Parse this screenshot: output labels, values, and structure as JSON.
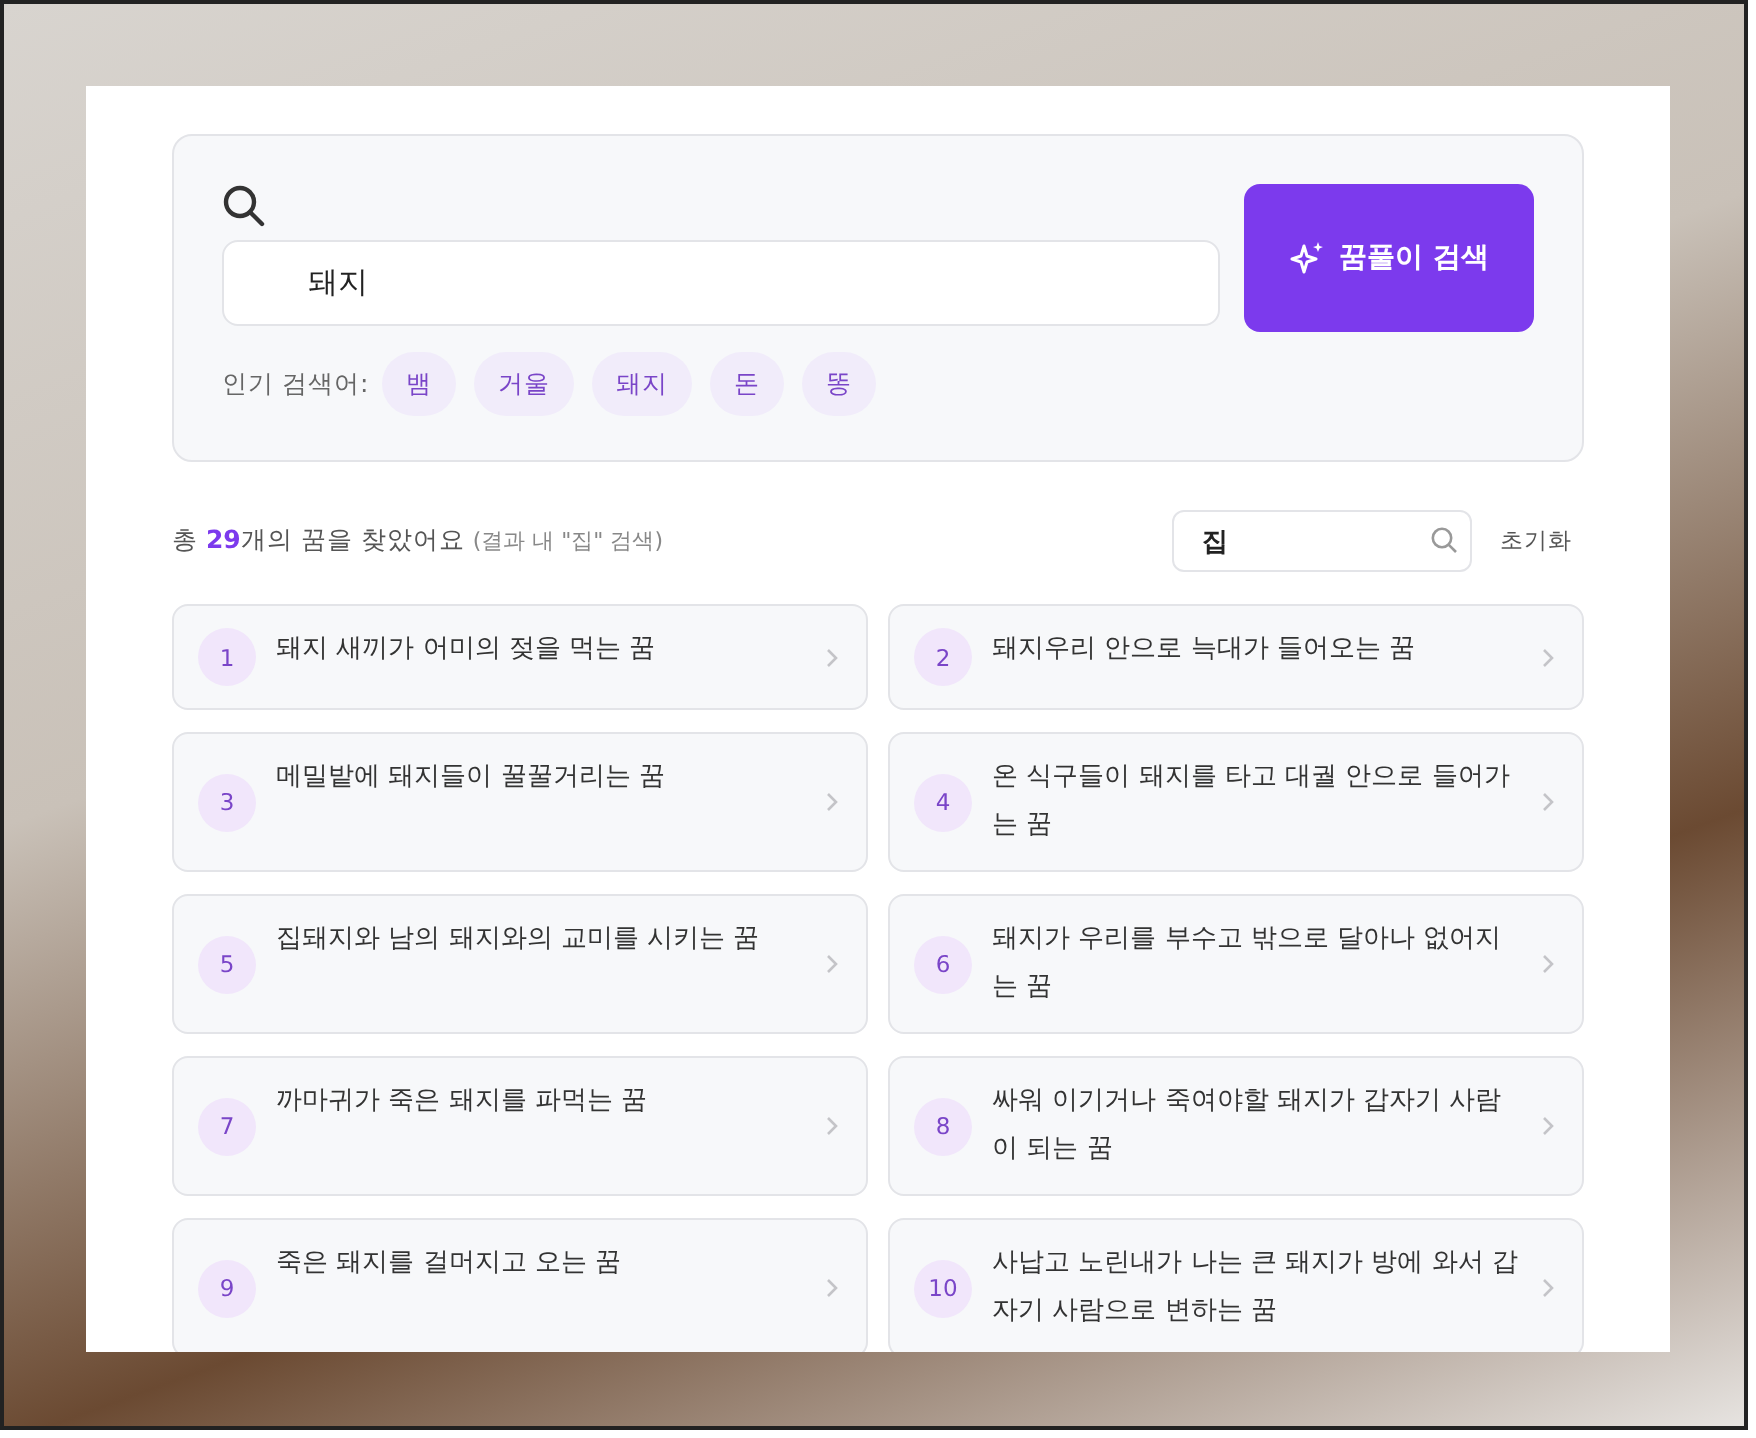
{
  "search": {
    "value": "돼지",
    "button": "꿈풀이 검색",
    "popular_label": "인기 검색어:",
    "popular": [
      "뱀",
      "거울",
      "돼지",
      "돈",
      "똥"
    ]
  },
  "results": {
    "summary": "총 **29**개의 꿈을 찾았어요",
    "note": "(결과 내 \"집\" 검색)",
    "filter_value": "집",
    "reset": "초기화",
    "items": [
      {
        "number": "1",
        "title": "돼지 새끼가 어미의 젖을 먹는 꿈"
      },
      {
        "number": "2",
        "title": "돼지우리 안으로 늑대가 들어오는 꿈"
      },
      {
        "number": "3",
        "title": "메밀밭에 돼지들이 꿀꿀거리는 꿈"
      },
      {
        "number": "4",
        "title": "온 식구들이 돼지를 타고 대궐 안으로 들어가는 꿈"
      },
      {
        "number": "5",
        "title": "집돼지와 남의 돼지와의 교미를 시키는 꿈"
      },
      {
        "number": "6",
        "title": "돼지가 우리를 부수고 밖으로 달아나 없어지는 꿈"
      },
      {
        "number": "7",
        "title": "까마귀가 죽은 돼지를 파먹는 꿈"
      },
      {
        "number": "8",
        "title": "싸워 이기거나 죽여야할 돼지가 갑자기 사람이 되는 꿈"
      },
      {
        "number": "9",
        "title": "죽은 돼지를 걸머지고 오는 꿈"
      },
      {
        "number": "10",
        "title": "사납고 노린내가 나는 큰 돼지가 방에 와서 갑자기 사람으로 변하는 꿈"
      }
    ]
  }
}
